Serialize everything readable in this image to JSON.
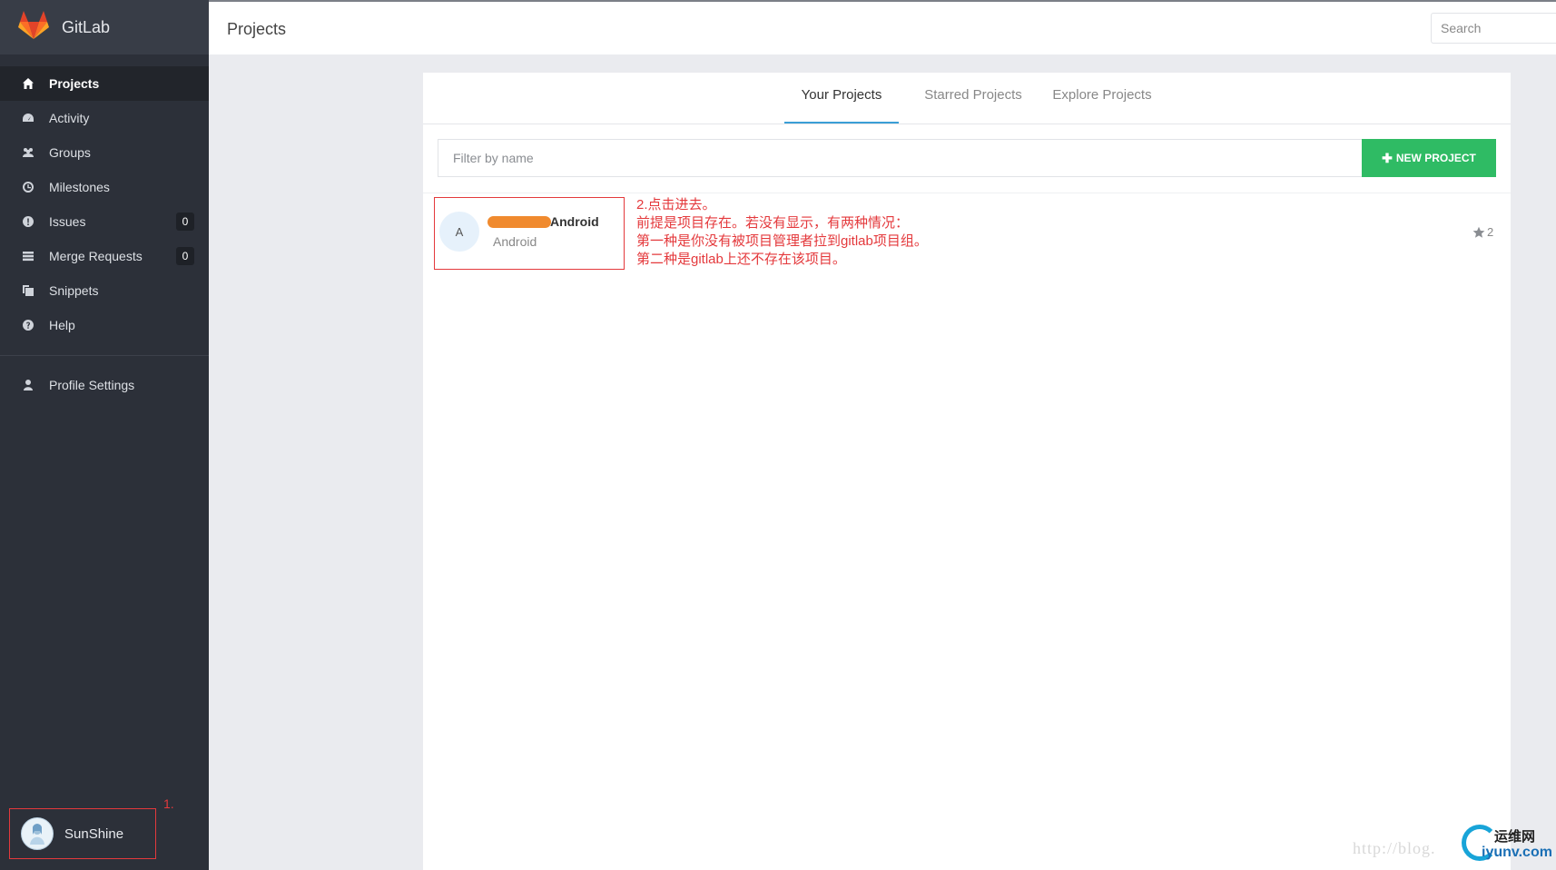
{
  "app": {
    "name": "GitLab"
  },
  "header": {
    "title": "Projects",
    "search_placeholder": "Search"
  },
  "sidebar": {
    "items": [
      {
        "label": "Projects",
        "icon": "home-icon",
        "active": true
      },
      {
        "label": "Activity",
        "icon": "dashboard-icon"
      },
      {
        "label": "Groups",
        "icon": "group-icon"
      },
      {
        "label": "Milestones",
        "icon": "clock-icon"
      },
      {
        "label": "Issues",
        "icon": "exclamation-icon",
        "badge": "0"
      },
      {
        "label": "Merge Requests",
        "icon": "list-icon",
        "badge": "0"
      },
      {
        "label": "Snippets",
        "icon": "copy-icon"
      },
      {
        "label": "Help",
        "icon": "question-icon"
      }
    ],
    "profile_label": "Profile Settings",
    "user_name": "SunShine",
    "annotation": "1."
  },
  "tabs": [
    {
      "label": "Your Projects",
      "active": true
    },
    {
      "label": "Starred Projects"
    },
    {
      "label": "Explore Projects"
    }
  ],
  "filter": {
    "placeholder": "Filter by name"
  },
  "new_project_label": "NEW PROJECT",
  "project": {
    "avatar_letter": "A",
    "name": "Android",
    "description": "Android",
    "stars": "2"
  },
  "annotation2": {
    "lines": [
      "2.点击进去。",
      "前提是项目存在。若没有显示，有两种情况：",
      "第一种是你没有被项目管理者拉到gitlab项目组。",
      "第二种是gitlab上还不存在该项目。"
    ]
  },
  "watermark": {
    "url_text": "http://blog.",
    "logo_cn": "运维网",
    "logo_en": "iyunv.com"
  },
  "colors": {
    "sidebar": "#2c3039",
    "accent": "#3a9fd6",
    "new_button": "#2fbb64",
    "annotation": "#e4393c",
    "logo_orange": "#e24329"
  }
}
